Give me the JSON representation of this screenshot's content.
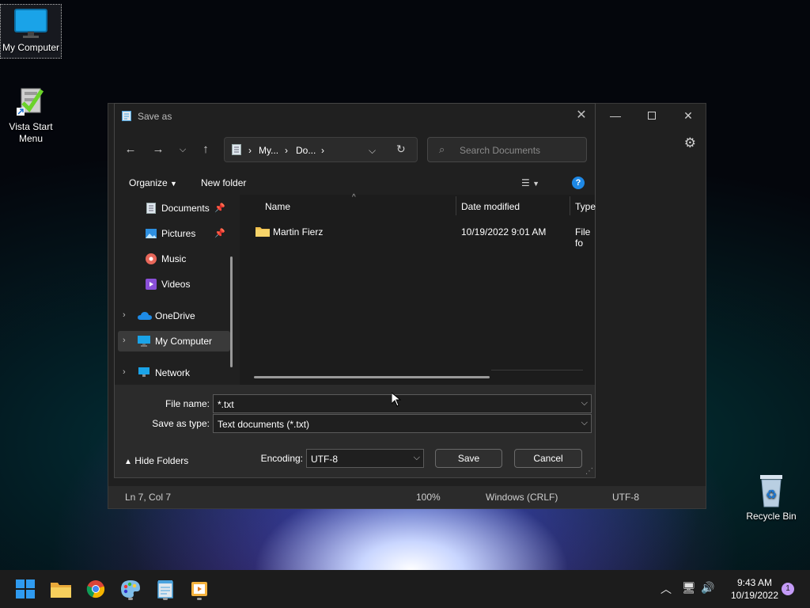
{
  "desktop": {
    "icons": [
      {
        "label": "My Computer"
      },
      {
        "label": "Vista Start Menu"
      },
      {
        "label": "Recycle Bin"
      }
    ]
  },
  "notepad": {
    "status": {
      "position": "Ln 7, Col 7",
      "zoom": "100%",
      "line_endings": "Windows (CRLF)",
      "encoding": "UTF-8"
    }
  },
  "dialog": {
    "title": "Save as",
    "address": {
      "crumb1": "My...",
      "crumb2": "Do..."
    },
    "search_placeholder": "Search Documents",
    "toolbar": {
      "organize": "Organize",
      "new_folder": "New folder",
      "help": "?"
    },
    "nav": [
      {
        "label": "Documents"
      },
      {
        "label": "Pictures"
      },
      {
        "label": "Music"
      },
      {
        "label": "Videos"
      },
      {
        "label": "OneDrive"
      },
      {
        "label": "My Computer"
      },
      {
        "label": "Network"
      }
    ],
    "columns": {
      "name": "Name",
      "date": "Date modified",
      "type": "Type"
    },
    "files": [
      {
        "name": "Martin Fierz",
        "date": "10/19/2022 9:01 AM",
        "type": "File fo"
      }
    ],
    "file_name_label": "File name:",
    "file_name_value": "*.txt",
    "save_type_label": "Save as type:",
    "save_type_value": "Text documents (*.txt)",
    "hide_folders": "Hide Folders",
    "encoding_label": "Encoding:",
    "encoding_value": "UTF-8",
    "save": "Save",
    "cancel": "Cancel"
  },
  "taskbar": {
    "time": "9:43 AM",
    "date": "10/19/2022",
    "notification_count": "1"
  },
  "colors": {
    "accent": "#1e88e5",
    "dialog_bg": "#2b2b2b",
    "taskbar_bg": "#1c1c1c"
  }
}
